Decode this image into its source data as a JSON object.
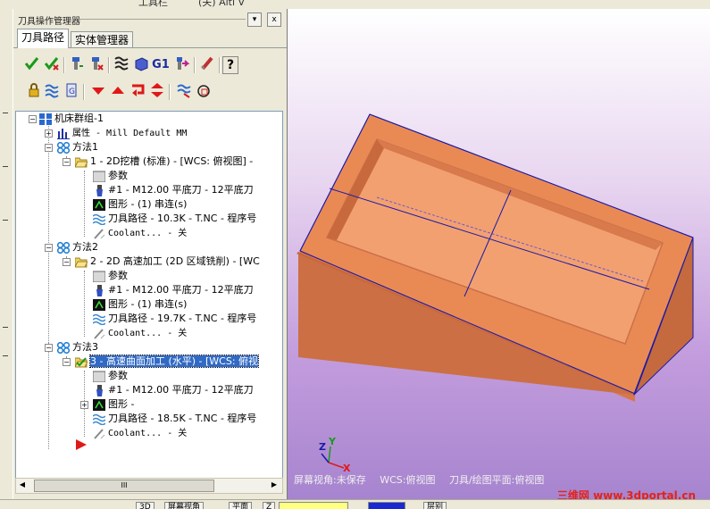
{
  "top_strip": {
    "text1": "工具栏",
    "text2": "(关) Altl V"
  },
  "manager": {
    "title": "刀具操作管理器",
    "dropdown_glyph": "▾",
    "close_glyph": "x",
    "tabs": [
      {
        "label": "刀具路径",
        "active": true
      },
      {
        "label": "实体管理器",
        "active": false
      }
    ],
    "toolbar1_icons": [
      "select-all-ops-icon",
      "select-dirty-ops-icon",
      "regenerate-all-icon",
      "regenerate-dirty-icon",
      "backplot-icon",
      "verify-icon",
      "g1-label",
      "post-selected-icon",
      "high-speed-icon",
      "help-icon"
    ],
    "g1_text": "G1",
    "help_text": "?",
    "toolbar2_icons": [
      "lock-icon",
      "toggle-toolpath-display-icon",
      "toggle-posting-icon",
      "move-down-icon",
      "move-up-icon",
      "insert-arrow-icon",
      "scroll-icon",
      "only-selected-display-icon",
      "show-associated-geometry-icon"
    ],
    "tree": {
      "root": "机床群组-1",
      "properties": "属性 - Mill Default MM",
      "groups": [
        {
          "name": "方法1",
          "op": "1 - 2D挖槽 (标准) - [WCS: 俯视图] -",
          "children": [
            "参数",
            "#1 - M12.00 平底刀 - 12平底刀",
            "图形 - (1) 串连(s)",
            "刀具路径 - 10.3K - T.NC - 程序号",
            "Coolant... - 关"
          ]
        },
        {
          "name": "方法2",
          "op": "2 - 2D 高速加工 (2D 区域铣削) - [WC",
          "children": [
            "参数",
            "#1 - M12.00 平底刀 - 12平底刀",
            "图形 - (1) 串连(s)",
            "刀具路径 - 19.7K - T.NC - 程序号",
            "Coolant... - 关"
          ]
        },
        {
          "name": "方法3",
          "op": "3 - 高速曲面加工 (水平) - [WCS: 俯视",
          "children": [
            "参数",
            "#1 - M12.00 平底刀 - 12平底刀",
            "图形 -",
            "刀具路径 - 18.5K - T.NC - 程序号",
            "Coolant... - 关"
          ]
        }
      ]
    },
    "scroll_thumb": "III"
  },
  "viewport": {
    "info_view": "屏幕视角:未保存",
    "info_wcs": "WCS:俯视图",
    "info_plane": "刀具/绘图平面:俯视图",
    "watermark": "三维网 www.3dportal.cn",
    "axis_x": "X",
    "axis_y": "Y",
    "axis_z": "Z",
    "colors": {
      "part_top": "#f0955e",
      "part_side": "#d9774a",
      "edge": "#1a1aa8"
    }
  },
  "status_bar": {
    "items": [
      "3D",
      "屏幕视角",
      "平面",
      "Z",
      "层别"
    ]
  }
}
